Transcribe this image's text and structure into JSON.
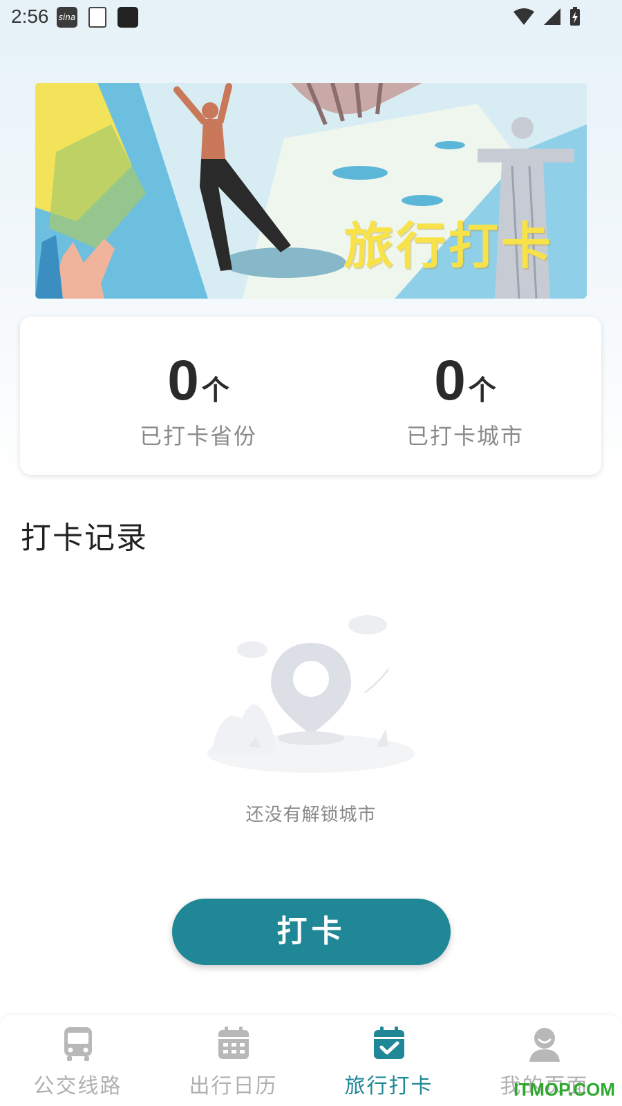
{
  "status_bar": {
    "time": "2:56",
    "sina_label": "sina"
  },
  "banner": {
    "title": "旅行打卡"
  },
  "stats": {
    "provinces": {
      "count": "0",
      "unit": "个",
      "label": "已打卡省份"
    },
    "cities": {
      "count": "0",
      "unit": "个",
      "label": "已打卡城市"
    }
  },
  "records": {
    "title": "打卡记录",
    "empty_text": "还没有解锁城市"
  },
  "checkin_button": {
    "label": "打卡"
  },
  "bottom_nav": {
    "items": [
      {
        "label": "公交线路",
        "icon": "bus-icon",
        "active": false
      },
      {
        "label": "出行日历",
        "icon": "calendar-icon",
        "active": false
      },
      {
        "label": "旅行打卡",
        "icon": "calendar-check-icon",
        "active": true
      },
      {
        "label": "我的页面",
        "icon": "user-icon",
        "active": false
      }
    ]
  },
  "watermark": "ITMOP.COM",
  "colors": {
    "accent": "#1f8796",
    "inactive": "#b0b0b0",
    "banner_title": "#f7e24a"
  }
}
